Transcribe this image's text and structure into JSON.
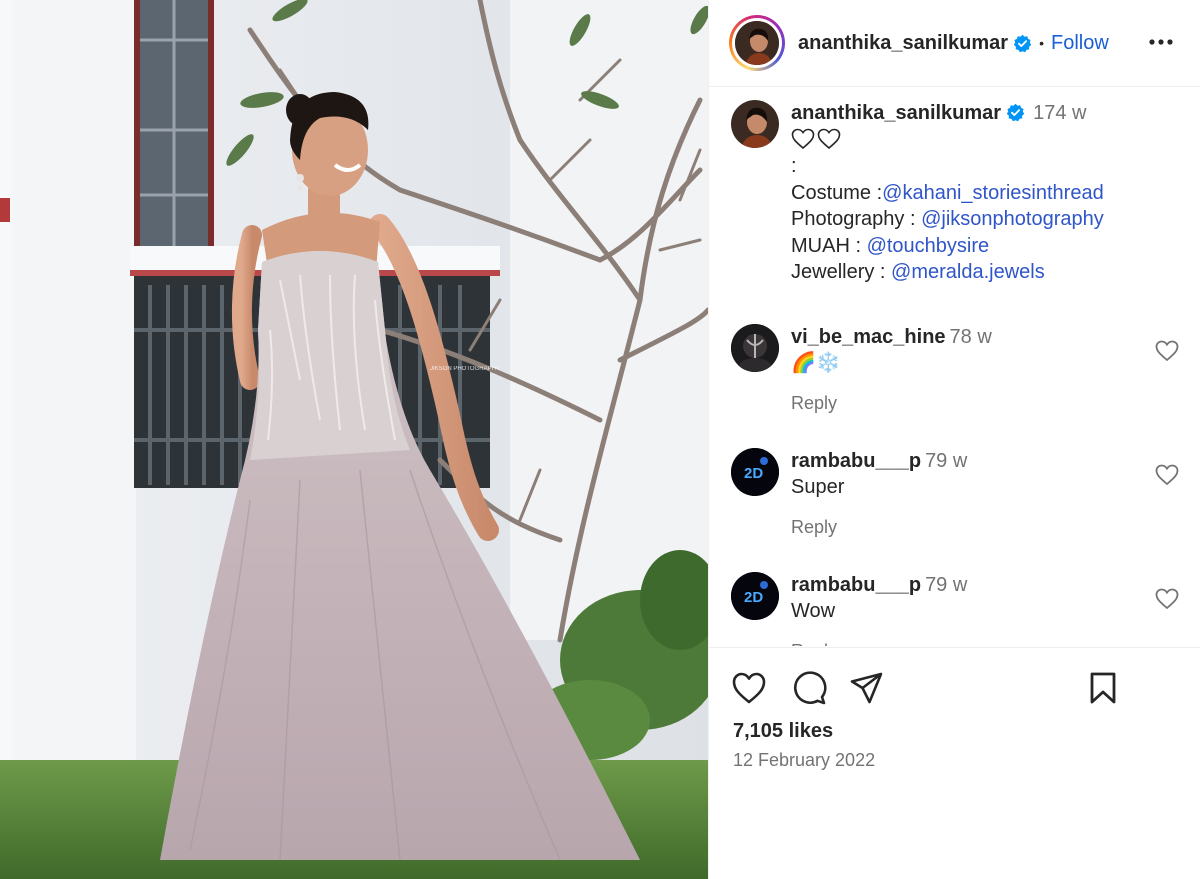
{
  "post": {
    "username": "ananthika_sanilkumar",
    "follow_label": "Follow",
    "separator": "•",
    "photo_watermark": "JIKSON PHOTOGRAPHY"
  },
  "caption": {
    "username": "ananthika_sanilkumar",
    "time": "174 w",
    "colon": ":",
    "lines": [
      {
        "label": "Costume :",
        "mention": "@kahani_storiesinthread"
      },
      {
        "label": "Photography : ",
        "mention": "@jiksonphotography"
      },
      {
        "label": "MUAH : ",
        "mention": "@touchbysire"
      },
      {
        "label": "Jewellery : ",
        "mention": "@meralda.jewels"
      }
    ]
  },
  "comments": [
    {
      "username": "vi_be_mac_hine",
      "time": "78 w",
      "text": "🌈❄️",
      "reply": "Reply"
    },
    {
      "username": "rambabu___p",
      "time": "79 w",
      "text": "Super",
      "reply": "Reply"
    },
    {
      "username": "rambabu___p",
      "time": "79 w",
      "text": "Wow",
      "reply": "Reply"
    }
  ],
  "footer": {
    "likes": "7,105 likes",
    "date": "12 February 2022"
  },
  "colors": {
    "link": "#2f55c9",
    "follow": "#1a5fd6",
    "verified": "#0095f6",
    "muted": "#737373"
  },
  "icons": [
    "verified-badge-icon",
    "more-options-icon",
    "heart-icon",
    "comment-icon",
    "share-icon",
    "bookmark-icon"
  ]
}
